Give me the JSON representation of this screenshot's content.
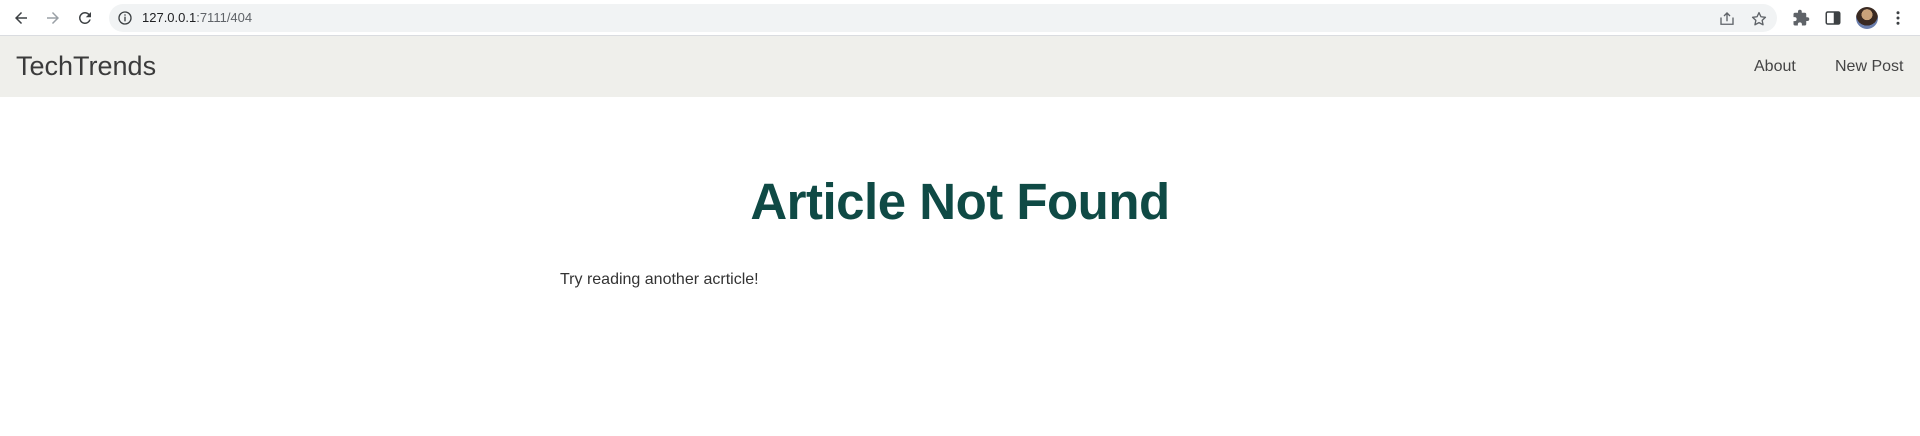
{
  "browser": {
    "url_host": "127.0.0.1",
    "url_path": ":7111/404"
  },
  "navbar": {
    "brand": "TechTrends",
    "links": [
      {
        "label": "About"
      },
      {
        "label": "New Post"
      }
    ],
    "background": "#efefeb"
  },
  "content": {
    "title": "Article Not Found",
    "message": "Try reading another acrticle!",
    "title_color": "#0f4a45"
  },
  "icons": {
    "back": "arrow-left-icon",
    "forward": "arrow-right-icon",
    "reload": "reload-icon",
    "site_info": "info-icon",
    "share": "share-icon",
    "bookmark": "star-icon",
    "extensions": "puzzle-icon",
    "side_panel": "side-panel-icon",
    "profile": "avatar",
    "menu": "kebab-menu-icon"
  }
}
